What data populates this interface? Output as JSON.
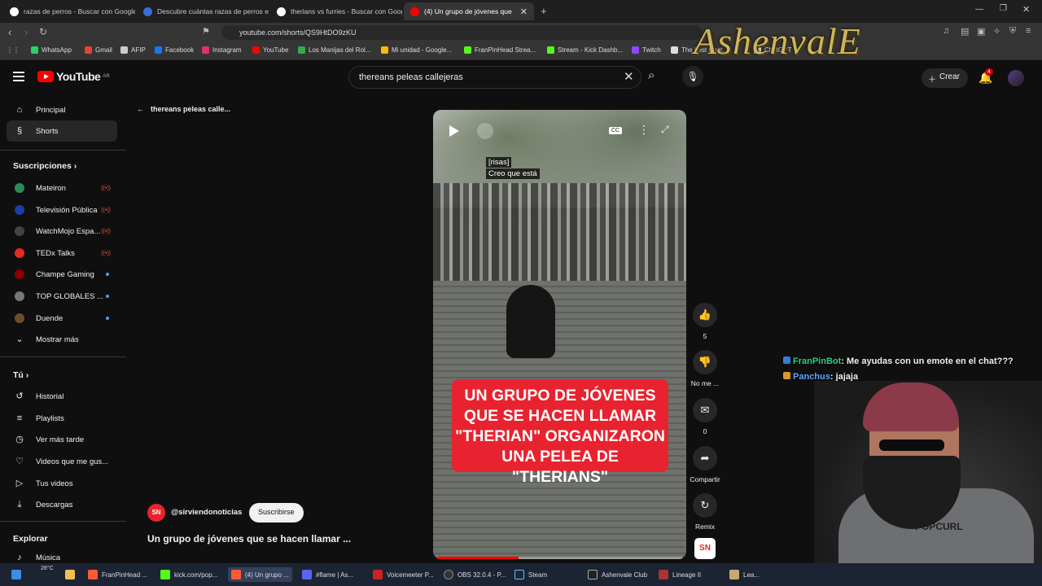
{
  "browser": {
    "tabs": [
      {
        "label": "razas de perros - Buscar con Google",
        "color": "#ffffff"
      },
      {
        "label": "Descubre cuántas razas de perros ex",
        "color": "#3b6fd8"
      },
      {
        "label": "therians vs furries - Buscar con Goog",
        "color": "#ffffff"
      },
      {
        "label": "(4) Un grupo de jóvenes que",
        "color": "#ff0000"
      }
    ],
    "new_tab": "+",
    "url": "youtube.com/shorts/QS9HtDO9zKU",
    "bookmarks": [
      {
        "label": "WhatsApp",
        "color": "#25d366"
      },
      {
        "label": "Gmail",
        "color": "#ea4335"
      },
      {
        "label": "AFIP",
        "color": "#cccccc"
      },
      {
        "label": "Facebook",
        "color": "#1877f2"
      },
      {
        "label": "Instagram",
        "color": "#e1306c"
      },
      {
        "label": "YouTube",
        "color": "#ff0000"
      },
      {
        "label": "Los Manijas del Rol...",
        "color": "#34a853"
      },
      {
        "label": "Mi unidad - Google...",
        "color": "#fbbc05"
      },
      {
        "label": "FranPinHead Strea...",
        "color": "#53fc18"
      },
      {
        "label": "Stream - Kick Dashb...",
        "color": "#53fc18"
      },
      {
        "label": "Twitch",
        "color": "#9146ff"
      },
      {
        "label": "The best Chat...",
        "color": "#dddddd"
      },
      {
        "label": "ChatGPT",
        "color": "#dddddd"
      }
    ],
    "overlay_logo": "AshenvalE"
  },
  "youtube": {
    "logo": "YouTube",
    "logo_region": "AR",
    "search_value": "thereans peleas callejeras",
    "create_label": "Crear",
    "notifications": "4"
  },
  "sidebar": {
    "main": [
      {
        "label": "Principal",
        "icon": "home-icon",
        "glyph": "⌂"
      },
      {
        "label": "Shorts",
        "icon": "shorts-icon",
        "glyph": "§"
      }
    ],
    "subs_header": "Suscripciones",
    "subscriptions": [
      {
        "label": "Mateiron",
        "color": "#2e8b57",
        "status": "live"
      },
      {
        "label": "Televisión Pública",
        "color": "#1a3ea8",
        "status": "live"
      },
      {
        "label": "WatchMojo Espa...",
        "color": "#444444",
        "status": "live"
      },
      {
        "label": "TEDx Talks",
        "color": "#e62b1e",
        "status": "live"
      },
      {
        "label": "Champe Gaming",
        "color": "#8b0000",
        "status": "new"
      },
      {
        "label": "TOP GLOBALES ...",
        "color": "#777777",
        "status": "new"
      },
      {
        "label": "Duende",
        "color": "#6b4f2a",
        "status": "new"
      }
    ],
    "show_more": "Mostrar más",
    "you_header": "Tú",
    "you_items": [
      {
        "label": "Historial",
        "glyph": "↺"
      },
      {
        "label": "Playlists",
        "glyph": "≡"
      },
      {
        "label": "Ver más tarde",
        "glyph": "◷"
      },
      {
        "label": "Videos que me gus...",
        "glyph": "♡"
      },
      {
        "label": "Tus videos",
        "glyph": "▷"
      },
      {
        "label": "Descargas",
        "glyph": "⤓"
      }
    ],
    "explore_header": "Explorar",
    "explore_items": [
      {
        "label": "Música",
        "glyph": "♪"
      }
    ]
  },
  "short": {
    "back_label": "thereans peleas calle...",
    "captions": [
      "[risas]",
      "Creo que está"
    ],
    "headline": "UN GRUPO DE JÓVENES QUE SE HACEN LLAMAR \"THERIAN\" ORGANIZARON UNA PELEA DE \"THERIANS\"",
    "cc": "CC",
    "progress": 0.33,
    "channel_initials": "SN",
    "channel_handle": "@sirviendonoticias",
    "subscribe": "Suscribirse",
    "title": "Un grupo de jóvenes que se hacen llamar ...",
    "actions": [
      {
        "glyph": "👍",
        "label": "5"
      },
      {
        "glyph": "👎",
        "label": "No me ..."
      },
      {
        "glyph": "✉",
        "label": "0"
      },
      {
        "glyph": "➦",
        "label": "Compartir"
      },
      {
        "glyph": "↻",
        "label": "Remix"
      }
    ]
  },
  "chat": [
    {
      "user": "FranPinBot",
      "message": ": Me ayudas con un emote en el chat???"
    },
    {
      "user": "Panchus",
      "message": ": jajaja"
    }
  ],
  "webcam": {
    "shirt_text": "POPCURL"
  },
  "taskbar": {
    "weather": "28°C",
    "items": [
      {
        "label": "FranPinHead ...",
        "color": "#ff5a36"
      },
      {
        "label": "kick.com/pop...",
        "color": "#53fc18"
      },
      {
        "label": "(4) Un grupo ...",
        "color": "#ff5a36"
      },
      {
        "label": "#flame | As...",
        "color": "#5865f2"
      },
      {
        "label": "Voicemeeter P...",
        "color": "#cc2222"
      },
      {
        "label": "OBS 32.0.4 - P...",
        "color": "#333333"
      },
      {
        "label": "Steam",
        "color": "#1b2838"
      },
      {
        "label": "Ashenvale Club",
        "color": "#222222"
      },
      {
        "label": "Lineage II",
        "color": "#aa3333"
      },
      {
        "label": "Lea...",
        "color": "#c8aa6e"
      }
    ]
  }
}
